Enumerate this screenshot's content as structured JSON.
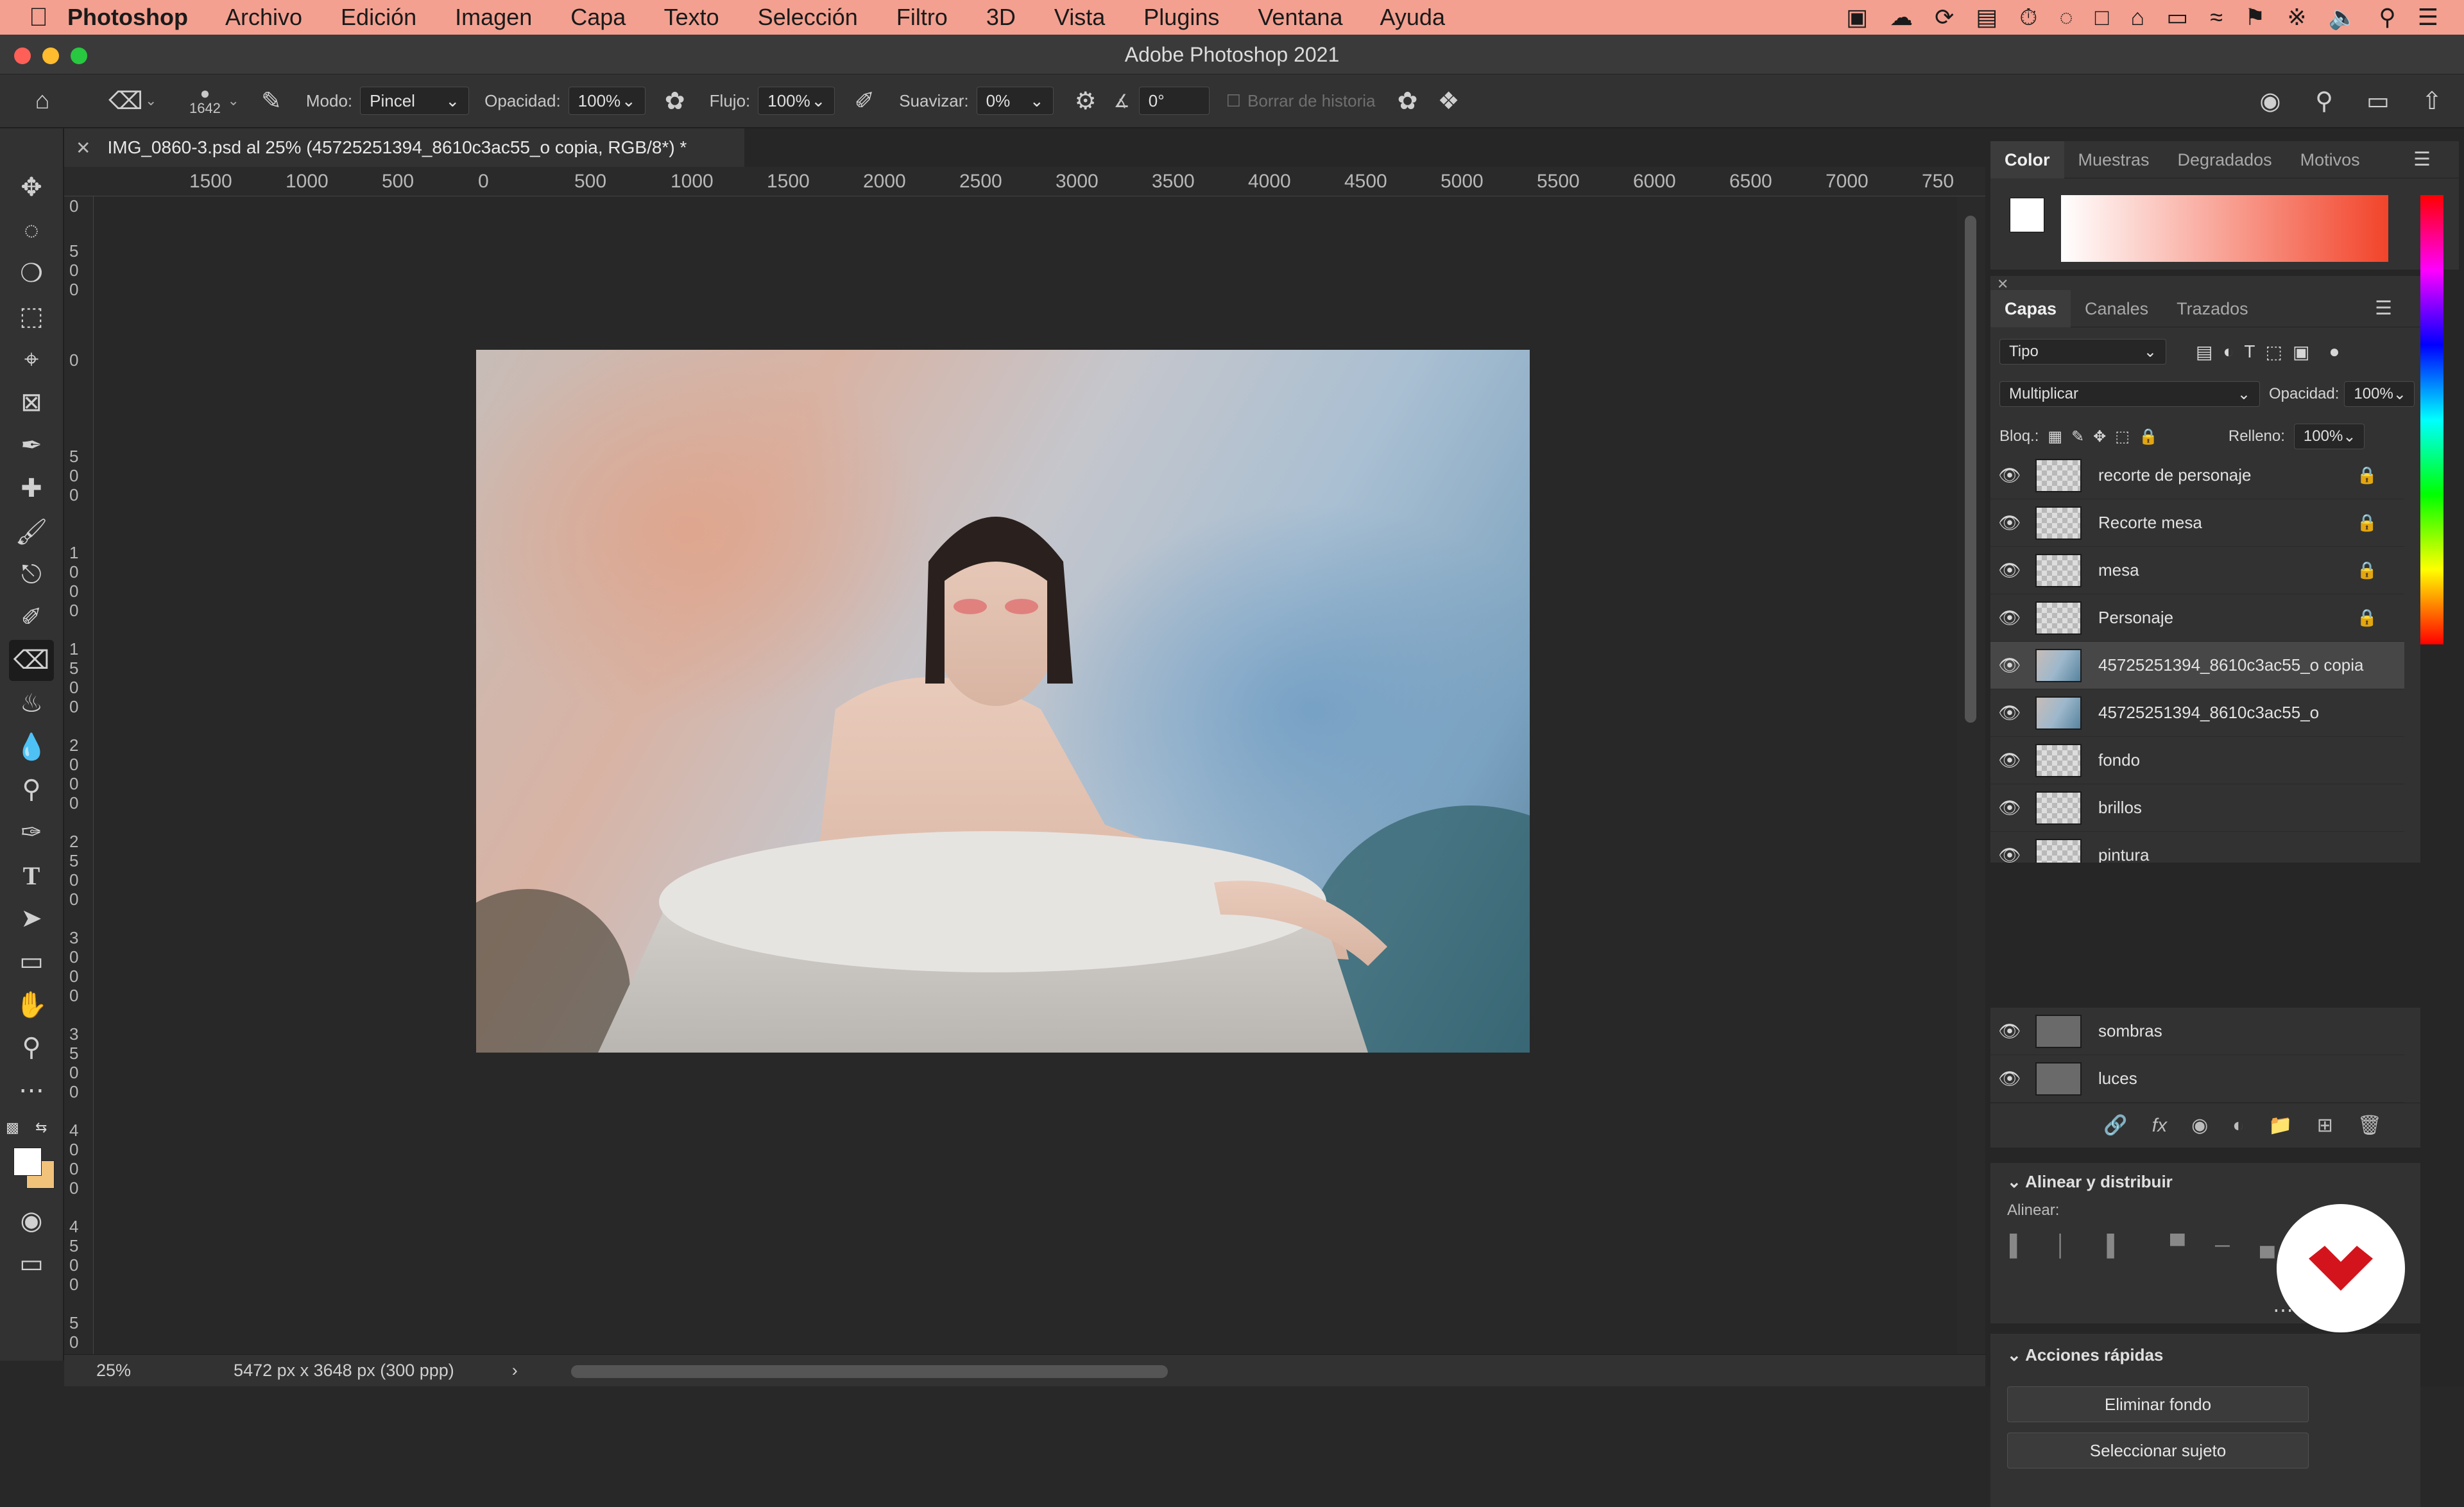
{
  "macmenu": {
    "apple": "",
    "app": "Photoshop",
    "items": [
      "Archivo",
      "Edición",
      "Imagen",
      "Capa",
      "Texto",
      "Selección",
      "Filtro",
      "3D",
      "Vista",
      "Plugins",
      "Ventana",
      "Ayuda"
    ]
  },
  "window": {
    "title": "Adobe Photoshop 2021"
  },
  "options": {
    "brush_size": "1642",
    "mode_label": "Modo:",
    "mode_value": "Pincel",
    "opacity_label": "Opacidad:",
    "opacity_value": "100%",
    "flow_label": "Flujo:",
    "flow_value": "100%",
    "smooth_label": "Suavizar:",
    "smooth_value": "0%",
    "angle_value": "0°",
    "erase_history": "Borrar de historia"
  },
  "document": {
    "tab_title": "IMG_0860-3.psd al 25% (45725251394_8610c3ac55_o copia, RGB/8*) *",
    "zoom": "25%",
    "size_info": "5472 px x 3648 px (300 ppp)"
  },
  "rulers": {
    "top": [
      "1500",
      "1000",
      "500",
      "0",
      "500",
      "1000",
      "1500",
      "2000",
      "2500",
      "3000",
      "3500",
      "4000",
      "4500",
      "5000",
      "5500",
      "6000",
      "6500",
      "7000",
      "750"
    ],
    "left": [
      "0",
      "500",
      "0",
      "500",
      "1000",
      "1500",
      "2000",
      "2500",
      "3000",
      "3500",
      "4000",
      "4500",
      "50"
    ]
  },
  "color_panel": {
    "tabs": [
      "Color",
      "Muestras",
      "Degradados",
      "Motivos"
    ]
  },
  "layers_panel": {
    "tabs": [
      "Capas",
      "Canales",
      "Trazados"
    ],
    "filter": "Tipo",
    "blend_mode": "Multiplicar",
    "opacity_label": "Opacidad:",
    "opacity": "100%",
    "lock_label": "Bloq.:",
    "fill_label": "Relleno:",
    "fill": "100%",
    "layers": [
      {
        "name": "recorte de personaje",
        "locked": true
      },
      {
        "name": "Recorte mesa",
        "locked": true
      },
      {
        "name": "mesa",
        "locked": true
      },
      {
        "name": "Personaje",
        "locked": true
      },
      {
        "name": "45725251394_8610c3ac55_o copia",
        "locked": false,
        "selected": true
      },
      {
        "name": "45725251394_8610c3ac55_o",
        "locked": false
      },
      {
        "name": "fondo",
        "locked": false
      },
      {
        "name": "brillos",
        "locked": false
      },
      {
        "name": "pintura",
        "locked": false
      },
      {
        "name": "sombras",
        "locked": false
      },
      {
        "name": "luces",
        "locked": false
      }
    ]
  },
  "align_panel": {
    "title": "Alinear y distribuir",
    "align_label": "Alinear:"
  },
  "quick_actions": {
    "title": "Acciones rápidas",
    "remove_bg": "Eliminar fondo",
    "select_subject": "Seleccionar sujeto"
  }
}
